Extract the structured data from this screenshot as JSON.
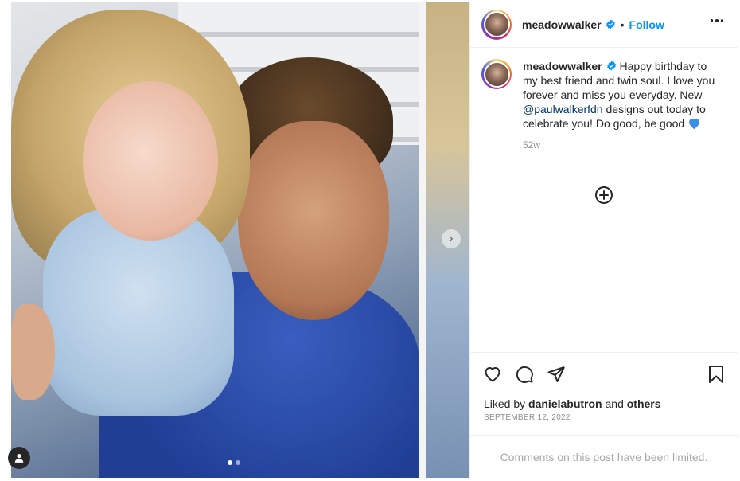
{
  "post": {
    "media": {
      "slide_count": 2,
      "active_slide": 1,
      "next_icon": "chevron-right-icon",
      "tagged_users_icon": "user-icon"
    },
    "header": {
      "username": "meadowwalker",
      "verified_icon": "verified-badge-icon",
      "separator": "•",
      "follow_label": "Follow",
      "more_icon": "more-options-icon"
    },
    "caption": {
      "username": "meadowwalker",
      "text_before_mention": "Happy birthday to my best friend and twin soul. I love you forever and miss you everyday. New ",
      "mention": "@paulwalkerfdn",
      "text_after_mention": " designs out today to celebrate you! Do good, be good ",
      "emoji": "💙",
      "time_ago": "52w"
    },
    "load_more_icon": "plus-circle-icon",
    "actions": {
      "like_icon": "heart-icon",
      "comment_icon": "comment-icon",
      "share_icon": "share-icon",
      "save_icon": "bookmark-icon"
    },
    "likes": {
      "prefix": "Liked by",
      "liker": "danielabutron",
      "conjunction": "and",
      "others": "others"
    },
    "date": "SEPTEMBER 12, 2022",
    "comments_notice": "Comments on this post have been limited.",
    "colors": {
      "follow": "#0095f6",
      "mention": "#00376b",
      "verified": "#0095f6",
      "muted": "#8e8e8e"
    }
  }
}
